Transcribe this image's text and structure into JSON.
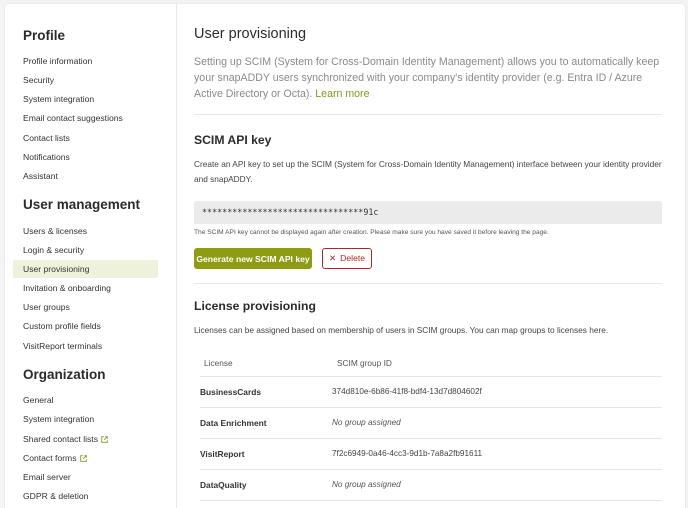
{
  "sidebar": {
    "sections": [
      {
        "title": "Profile",
        "items": [
          {
            "label": "Profile information"
          },
          {
            "label": "Security"
          },
          {
            "label": "System integration"
          },
          {
            "label": "Email contact suggestions"
          },
          {
            "label": "Contact lists"
          },
          {
            "label": "Notifications"
          },
          {
            "label": "Assistant"
          }
        ]
      },
      {
        "title": "User management",
        "items": [
          {
            "label": "Users & licenses"
          },
          {
            "label": "Login & security"
          },
          {
            "label": "User provisioning",
            "active": true
          },
          {
            "label": "Invitation & onboarding"
          },
          {
            "label": "User groups"
          },
          {
            "label": "Custom profile fields"
          },
          {
            "label": "VisitReport terminals"
          }
        ]
      },
      {
        "title": "Organization",
        "items": [
          {
            "label": "General"
          },
          {
            "label": "System integration"
          },
          {
            "label": "Shared contact lists",
            "external": true
          },
          {
            "label": "Contact forms",
            "external": true
          },
          {
            "label": "Email server"
          },
          {
            "label": "GDPR & deletion"
          }
        ]
      }
    ]
  },
  "main": {
    "title": "User provisioning",
    "intro_text": "Setting up SCIM (System for Cross-Domain Identity Management) allows you to automatically keep your snapADDY users synchronized with your company's identity provider (e.g. Entra ID / Azure Active Directory or Octa).",
    "learn_more": "Learn more",
    "api_key": {
      "heading": "SCIM API key",
      "description": "Create an API key to set up the SCIM (System for Cross-Domain Identity Management) interface between your identity provider and snapADDY.",
      "masked_value": "********************************91c",
      "hint": "The SCIM API key cannot be displayed again after creation. Please make sure you have saved it before leaving the page.",
      "generate_label": "Generate new SCIM API key",
      "delete_label": "Delete"
    },
    "licenses": {
      "heading": "License provisioning",
      "description": "Licenses can be assigned based on membership of users in SCIM groups. You can map groups to licenses here.",
      "col_license": "License",
      "col_group": "SCIM group ID",
      "rows": [
        {
          "license": "BusinessCards",
          "group": "374d810e-6b86-41f8-bdf4-13d7d804602f",
          "assigned": true
        },
        {
          "license": "Data Enrichment",
          "group": "No group assigned",
          "assigned": false
        },
        {
          "license": "VisitReport",
          "group": "7f2c6949-0a46-4cc3-9d1b-7a8a2fb91611",
          "assigned": true
        },
        {
          "license": "DataQuality",
          "group": "No group assigned",
          "assigned": false
        }
      ]
    }
  },
  "colors": {
    "accent": "#8e9b13",
    "link": "#7c9a1b",
    "danger": "#b3261e",
    "active_bg": "#eef2dc"
  }
}
